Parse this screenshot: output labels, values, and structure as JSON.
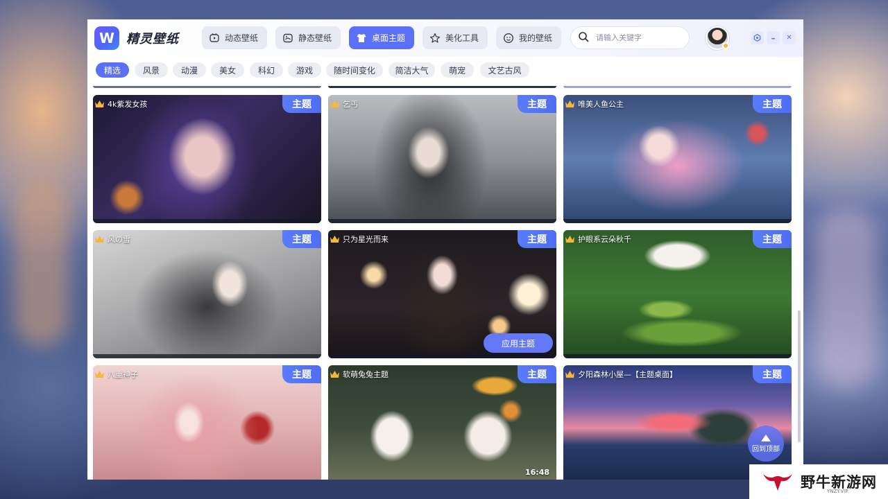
{
  "app": {
    "name": "精灵壁纸",
    "logo_letter": "W"
  },
  "nav_tabs": [
    {
      "label": "动态壁纸",
      "icon": "dynamic-wallpaper-icon"
    },
    {
      "label": "静态壁纸",
      "icon": "static-wallpaper-icon"
    },
    {
      "label": "桌面主题",
      "icon": "theme-shirt-icon",
      "active": true
    },
    {
      "label": "美化工具",
      "icon": "beautify-tool-icon"
    },
    {
      "label": "我的壁纸",
      "icon": "my-wallpaper-icon"
    }
  ],
  "search": {
    "placeholder": "请输入关键字",
    "value": ""
  },
  "window_controls": {
    "settings": "◉",
    "minimize": "–",
    "close": "✕"
  },
  "categories": [
    {
      "label": "精选",
      "active": true
    },
    {
      "label": "风景"
    },
    {
      "label": "动漫"
    },
    {
      "label": "美女"
    },
    {
      "label": "科幻"
    },
    {
      "label": "游戏"
    },
    {
      "label": "随时间变化"
    },
    {
      "label": "简洁大气"
    },
    {
      "label": "萌宠"
    },
    {
      "label": "文艺古风"
    }
  ],
  "cards": [
    {
      "title": "4k紫发女孩",
      "badge": "主题"
    },
    {
      "title": "乞丐",
      "badge": "主题"
    },
    {
      "title": "唯美人鱼公主",
      "badge": "主题"
    },
    {
      "title": "风の雪",
      "badge": "主题"
    },
    {
      "title": "只为星光而来",
      "badge": "主题",
      "hover_action": "应用主题"
    },
    {
      "title": "护眼系云朵秋千",
      "badge": "主题"
    },
    {
      "title": "八重神子",
      "badge": "主题"
    },
    {
      "title": "软萌兔兔主题",
      "badge": "主题",
      "clock": "16:48"
    },
    {
      "title": "夕阳森林小屋—【主题桌面】",
      "badge": "主题"
    }
  ],
  "back_to_top": {
    "label": "回到顶部"
  },
  "watermark": {
    "text": "野牛新游网",
    "sub": "YNZY.VIP"
  },
  "colors": {
    "accent": "#5b70f7",
    "badge": "#5a7cf9",
    "crown": "#f5b83a"
  }
}
